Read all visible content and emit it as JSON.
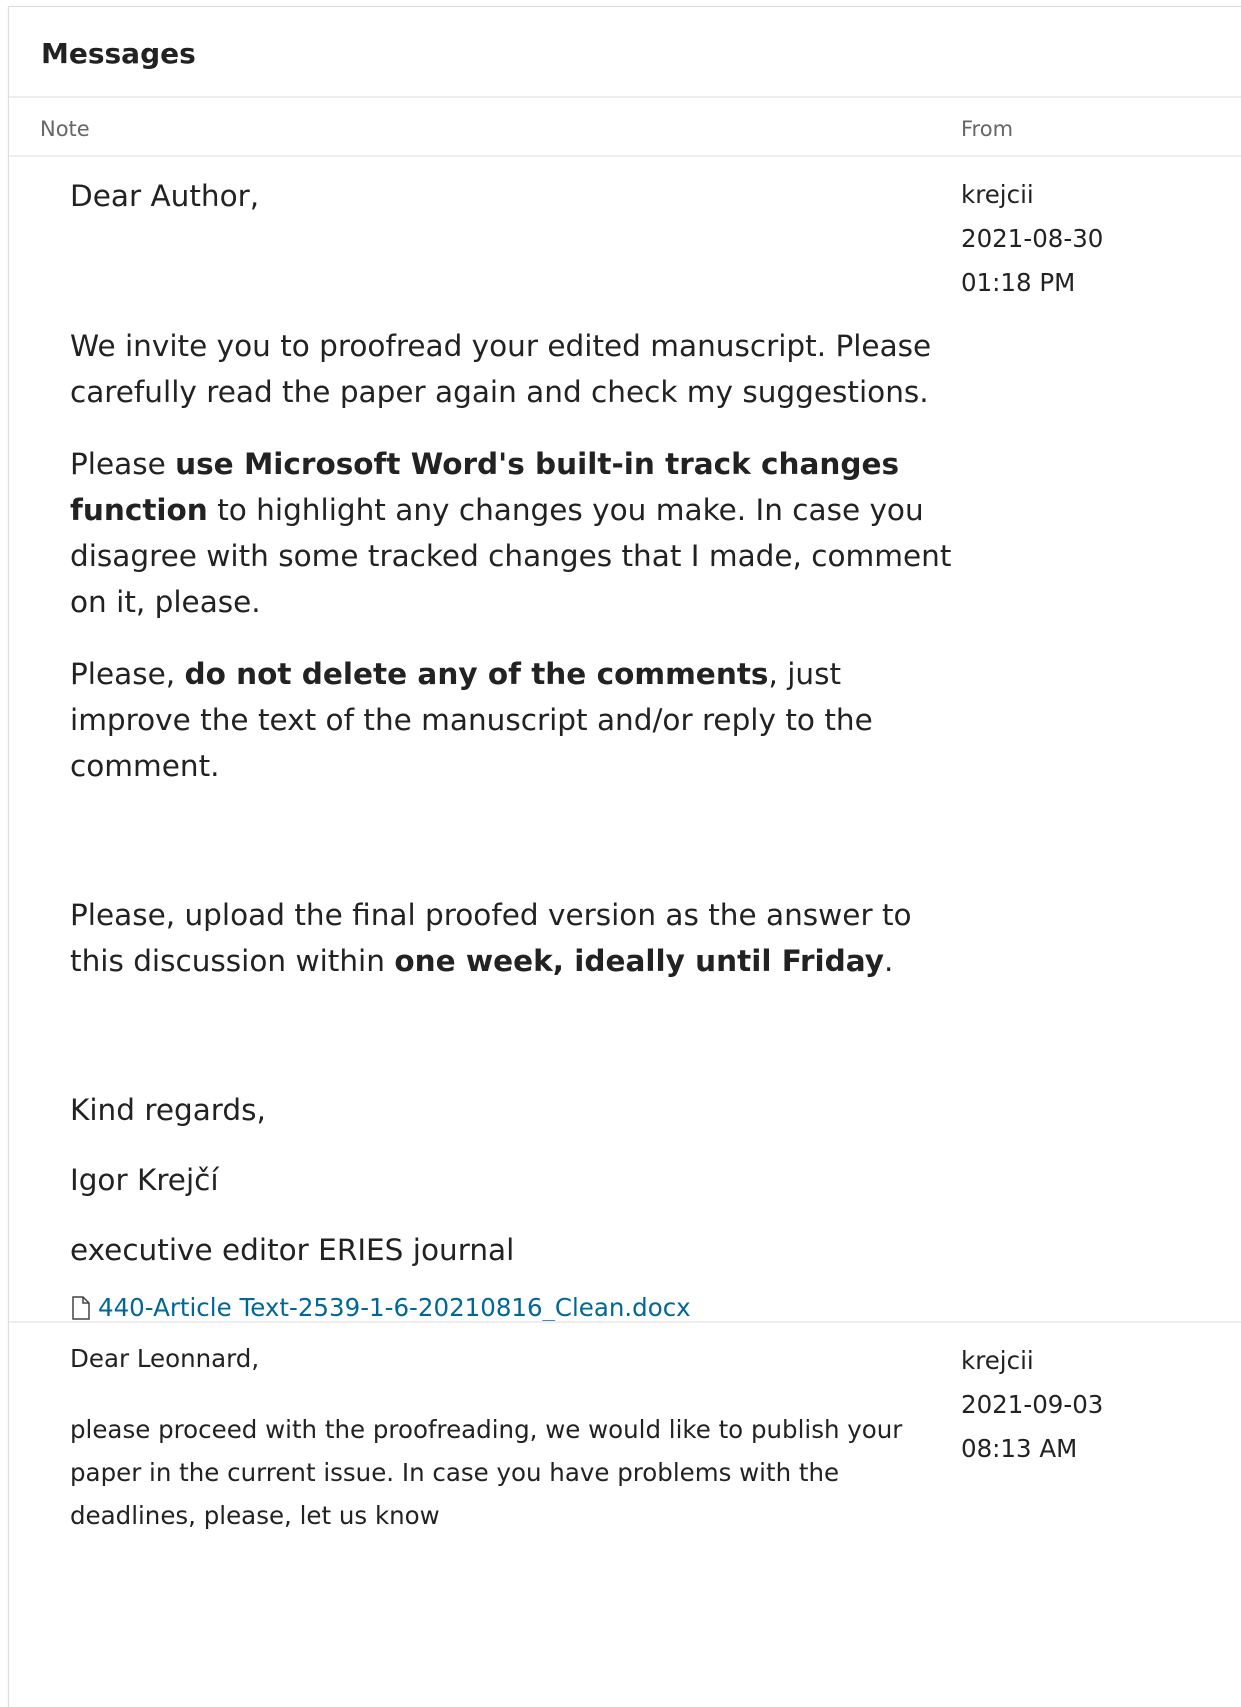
{
  "panel": {
    "title": "Messages"
  },
  "columns": {
    "note": "Note",
    "from": "From"
  },
  "messages": [
    {
      "greeting": "Dear Author,",
      "paragraphs": [
        "We invite you to proofread your edited manuscript. Please carefully read the paper again and check my suggestions.",
        {
          "a": "Please ",
          "b": "use Microsoft Word's built-in track changes function",
          "c": " to highlight any changes you make. In case you disagree with some tracked changes that I made, comment on it, please."
        },
        {
          "a": "Please, ",
          "b": "do not delete any of the comments",
          "c": ", just improve the text of the manuscript and/or reply to the comment."
        },
        {
          "a": "Please, upload the final proofed version as the answer to this discussion within ",
          "b": "one week, ideally until Friday",
          "c": "."
        },
        "Kind regards,",
        "Igor Krejčí",
        "executive editor ERIES journal"
      ],
      "attachment": {
        "icon": "file-icon",
        "name": "440-Article Text-2539-1-6-20210816_Clean.docx"
      },
      "from": {
        "user": "krejcii",
        "date": "2021-08-30",
        "time": "01:18 PM"
      }
    },
    {
      "greeting": "Dear Leonnard,",
      "paragraphs": [
        "please proceed with the proofreading, we would like to publish your paper in the current issue. In case you have problems with the deadlines, please, let us know"
      ],
      "from": {
        "user": "krejcii",
        "date": "2021-09-03",
        "time": "08:13 AM"
      }
    }
  ]
}
